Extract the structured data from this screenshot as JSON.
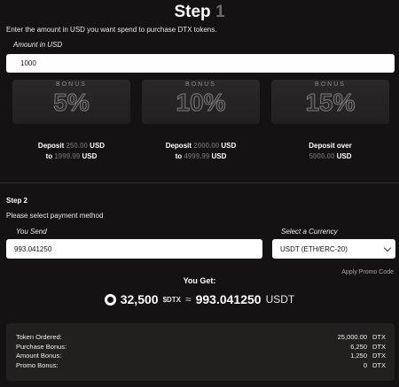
{
  "step1": {
    "title_prefix": "Step",
    "title_num": "1",
    "intro": "Enter the amount in USD you want spend to purchase DTX tokens.",
    "amount_label": "Amount in USD",
    "amount_value": "1000"
  },
  "bonuses": [
    {
      "word": "BONUS",
      "value": "5%"
    },
    {
      "word": "BONUS",
      "value": "10%"
    },
    {
      "word": "BONUS",
      "value": "15%"
    }
  ],
  "tiers": [
    {
      "line1_a": "Deposit ",
      "line1_b": "250.00",
      "line1_c": " USD",
      "line2_a": "to ",
      "line2_b": "1999.99",
      "line2_c": " USD"
    },
    {
      "line1_a": "Deposit ",
      "line1_b": "2000.00",
      "line1_c": " USD",
      "line2_a": "to ",
      "line2_b": "4999.99",
      "line2_c": " USD"
    },
    {
      "line1_a": "Deposit over",
      "line1_b": "",
      "line1_c": "",
      "line2_a": "",
      "line2_b": "5000.00",
      "line2_c": " USD"
    }
  ],
  "step2": {
    "title": "Step 2",
    "subtitle": "Please select payment method",
    "send_label": "You Send",
    "send_value": "993.041250",
    "currency_label": "Select a Currency",
    "currency_value": "USDT (ETH/ERC-20)",
    "promo": "Apply Promo Code"
  },
  "get": {
    "label": "You Get:",
    "amount": "32,500",
    "ticker": "$DTX",
    "approx": "≈",
    "usdt_amount": "993.041250",
    "usdt_cur": "USDT"
  },
  "summary": [
    {
      "label": "Token Ordered:",
      "value": "25,000.00",
      "unit": "DTX"
    },
    {
      "label": "Purchase Bonus:",
      "value": "6,250",
      "unit": "DTX"
    },
    {
      "label": "Amount Bonus:",
      "value": "1,250",
      "unit": "DTX"
    },
    {
      "label": "Promo Bonus:",
      "value": "0",
      "unit": "DTX"
    }
  ]
}
